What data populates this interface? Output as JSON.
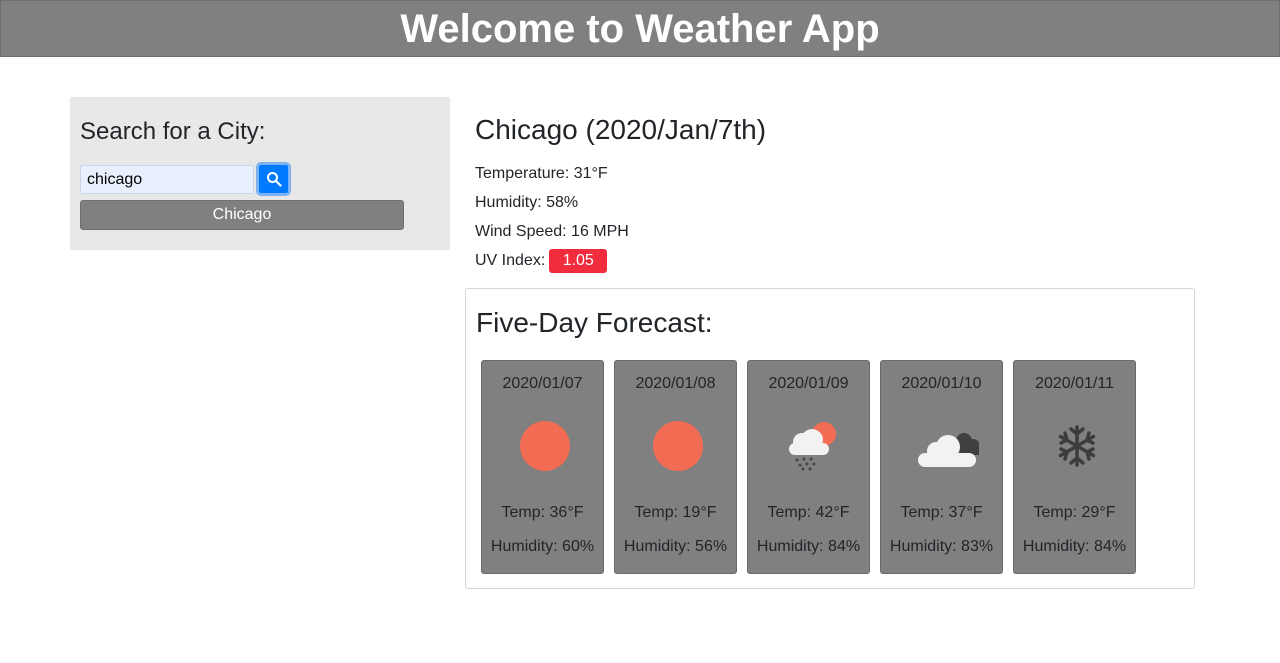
{
  "header": {
    "title": "Welcome to Weather App"
  },
  "sidebar": {
    "heading": "Search for a City:",
    "search_value": "chicago",
    "search_icon": "search-icon",
    "history": [
      "Chicago"
    ]
  },
  "current": {
    "title": "Chicago (2020/Jan/7th)",
    "temperature": "Temperature: 31°F",
    "humidity": "Humidity: 58%",
    "wind": "Wind Speed: 16 MPH",
    "uv_label": "UV Index:",
    "uv_value": "1.05",
    "uv_color": "#f02c3d"
  },
  "forecast": {
    "heading": "Five-Day Forecast:",
    "days": [
      {
        "date": "2020/01/07",
        "icon": "sun-icon",
        "temp": "Temp: 36°F",
        "humidity": "Humidity: 60%"
      },
      {
        "date": "2020/01/08",
        "icon": "sun-icon",
        "temp": "Temp: 19°F",
        "humidity": "Humidity: 56%"
      },
      {
        "date": "2020/01/09",
        "icon": "rain-sun-icon",
        "temp": "Temp: 42°F",
        "humidity": "Humidity: 84%"
      },
      {
        "date": "2020/01/10",
        "icon": "clouds-icon",
        "temp": "Temp: 37°F",
        "humidity": "Humidity: 83%"
      },
      {
        "date": "2020/01/11",
        "icon": "snowflake-icon",
        "temp": "Temp: 29°F",
        "humidity": "Humidity: 84%"
      }
    ]
  },
  "colors": {
    "header_bg": "#808080",
    "card_bg": "#808080",
    "accent": "#007bff",
    "sun": "#f26b53"
  }
}
